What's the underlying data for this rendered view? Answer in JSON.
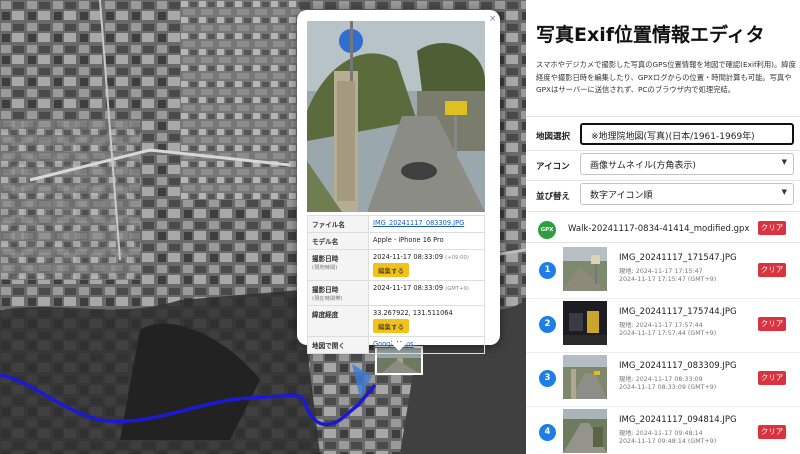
{
  "app": {
    "title": "写真Exif位置情報エディタ",
    "description": "スマホやデジカメで撮影した写真のGPS位置情報を地図で確認(Exif利用)。緯度経度や撮影日時を編集したり、GPXログからの位置・時間計算も可能。写真やGPXはサーバーに送信されず、PCのブラウザ内で処理完結。"
  },
  "controls": {
    "map_select": {
      "label": "地図選択",
      "value": "※地理院地図(写真)(日本/1961-1969年)"
    },
    "icon_select": {
      "label": "アイコン",
      "value": "画像サムネイル(方角表示)"
    },
    "sort_select": {
      "label": "並び替え",
      "value": "数字アイコン順"
    }
  },
  "gpx": {
    "badge": "GPX",
    "filename": "Walk-20241117-0834-41414_modified.gpx",
    "clear_label": "クリア"
  },
  "photos": [
    {
      "number": "1",
      "filename": "IMG_20241117_171547.JPG",
      "local_time": "現地: 2024-11-17 17:15:47",
      "gmt_time": "2024-11-17 17:15:47 (GMT+9)",
      "clear_label": "クリア"
    },
    {
      "number": "2",
      "filename": "IMG_20241117_175744.JPG",
      "local_time": "現地: 2024-11-17 17:57:44",
      "gmt_time": "2024-11-17 17:57:44 (GMT+9)",
      "clear_label": "クリア"
    },
    {
      "number": "3",
      "filename": "IMG_20241117_083309.JPG",
      "local_time": "現地: 2024-11-17 08:33:09",
      "gmt_time": "2024-11-17 08:33:09 (GMT+9)",
      "clear_label": "クリア"
    },
    {
      "number": "4",
      "filename": "IMG_20241117_094814.JPG",
      "local_time": "現地: 2024-11-17 09:48:14",
      "gmt_time": "2024-11-17 09:48:14 (GMT+9)",
      "clear_label": "クリア"
    }
  ],
  "popup": {
    "close": "×",
    "filename_label": "ファイル名",
    "filename": "IMG_20241117_083309.JPG",
    "model_label": "モデル名",
    "model": "Apple - iPhone 16 Pro",
    "shot_local_label": "撮影日時",
    "shot_local_sub": "(現地時間)",
    "shot_local_value": "2024-11-17 08:33:09",
    "shot_local_tz": "(+09:00)",
    "edit_label": "編集する",
    "shot_gmt_label": "撮影日時",
    "shot_gmt_sub": "(現在時間帯)",
    "shot_gmt_value": "2024-11-17 08:33:09",
    "shot_gmt_tz": "(GMT+9)",
    "latlng_label": "緯度経度",
    "latlng": "33.267922, 131.511064",
    "open_label": "地図で開く",
    "open_link": "GoogleMaps"
  },
  "colors": {
    "route": "#1a1ad6",
    "clear": "#d9333f",
    "number": "#1d7fe4",
    "gpx": "#2e9e3e",
    "edit": "#f2c21b"
  }
}
